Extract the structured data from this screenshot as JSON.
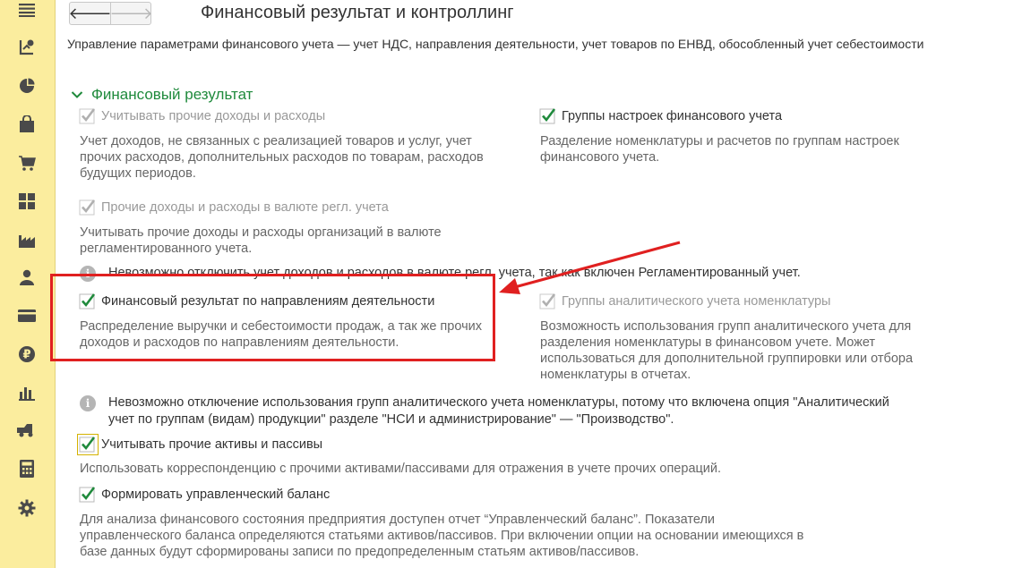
{
  "sidebar": {
    "icons": [
      "menu-icon",
      "tasks-icon",
      "pie-chart-icon",
      "bag-icon",
      "cart-icon",
      "grid-icon",
      "factory-icon",
      "person-icon",
      "card-icon",
      "ruble-icon",
      "bar-chart-icon",
      "truck-icon",
      "calculator-icon",
      "gear-icon"
    ]
  },
  "header": {
    "back_label": "🡐",
    "forward_label": "🡒",
    "title": "Финансовый результат и контроллинг",
    "subtitle": "Управление параметрами финансового учета — учет НДС, направления деятельности, учет товаров по ЕНВД, обособленный учет себестоимости"
  },
  "group": {
    "title": "Финансовый результат"
  },
  "options": {
    "other_income": {
      "label": "Учитывать прочие доходы и расходы",
      "checked": true,
      "disabled": true,
      "desc": [
        "Учет доходов, не связанных с реализацией товаров и услуг, учет",
        "прочих расходов, дополнительных расходов по товарам, расходов",
        "будущих периодов."
      ]
    },
    "settings_groups": {
      "label": "Группы настроек финансового учета",
      "checked": true,
      "disabled": false,
      "desc": [
        "Разделение номенклатуры и расчетов по группам настроек",
        "финансового учета."
      ]
    },
    "other_income_currency": {
      "label": "Прочие доходы и расходы в валюте регл. учета",
      "checked": true,
      "disabled": true,
      "desc": [
        "Учитывать прочие доходы и расходы организаций в валюте",
        "регламентированного учета."
      ]
    },
    "info_currency": "Невозможно отключить учет доходов и расходов в валюте регл. учета, так как включен Регламентированный учет.",
    "by_activity": {
      "label": "Финансовый результат по направлениям деятельности",
      "checked": true,
      "disabled": false,
      "desc": [
        "Распределение выручки и себестоимости продаж, а так же прочих",
        "доходов и расходов по направлениям деятельности."
      ]
    },
    "analytic_groups": {
      "label": "Группы аналитического учета номенклатуры",
      "checked": true,
      "disabled": true,
      "desc": [
        "Возможность использования групп аналитического учета для",
        "разделения номенклатуры в финансовом учете. Может",
        "использоваться для дополнительной группировки или отбора",
        "номенклатуры в отчетах."
      ]
    },
    "info_analytic": [
      "Невозможно отключение использования групп аналитического учета номенклатуры, потому что включена опция \"Аналитический",
      "учет по группам (видам) продукции\" разделе \"НСИ и администрирование\" — \"Производство\"."
    ],
    "other_assets": {
      "label": "Учитывать прочие активы и пассивы",
      "checked": true,
      "disabled": false,
      "desc": [
        "Использовать корреспонденцию с прочими активами/пассивами для отражения в учете прочих операций."
      ]
    },
    "mgmt_balance": {
      "label": "Формировать управленческий баланс",
      "checked": true,
      "disabled": false,
      "desc": [
        "Для анализа финансового состояния предприятия доступен отчет “Управленческий баланс”. Показатели",
        "управленческого баланса определяются статьями активов/пассивов. При включении опции на основании имеющихся в",
        "базе данных будут сформированы записи по предопределенным статьям активов/пассивов."
      ]
    }
  },
  "colors": {
    "sidebar_bg": "#fbed9e",
    "group_header": "#1f8a3c",
    "check_enabled": "#1f8a3c",
    "check_disabled": "#b0b0b0",
    "annotation_red": "#e02020"
  }
}
